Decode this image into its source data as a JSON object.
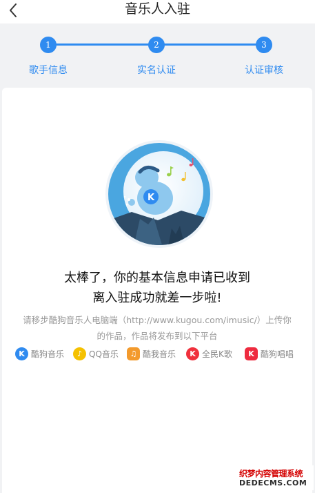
{
  "header": {
    "title": "音乐人入驻",
    "back_icon": "chevron-left-icon"
  },
  "steps": [
    {
      "number": "1",
      "label": "歌手信息"
    },
    {
      "number": "2",
      "label": "实名认证"
    },
    {
      "number": "3",
      "label": "认证审核"
    }
  ],
  "result": {
    "headline_line1": "太棒了，你的基本信息申请已收到",
    "headline_line2": "离入驻成功就差一步啦!",
    "desc_line1": "请移步酷狗音乐人电脑端（http://www.kugou.com/imusic/）上传你",
    "desc_line2": "的作品，作品将发布到以下平台"
  },
  "platforms": [
    {
      "label": "酷狗音乐",
      "icon": "kugou-icon",
      "color": "#2f8bf0",
      "glyph": "K"
    },
    {
      "label": "QQ音乐",
      "icon": "qqmusic-icon",
      "color": "#f5c100",
      "glyph": "♪"
    },
    {
      "label": "酷我音乐",
      "icon": "kuwo-icon",
      "color": "#f39a2c",
      "glyph": "♫"
    },
    {
      "label": "全民K歌",
      "icon": "quanmin-k-icon",
      "color": "#f0303c",
      "glyph": "K"
    },
    {
      "label": "酷狗唱唱",
      "icon": "kugou-changchang-icon",
      "color": "#ee2b3f",
      "glyph": "K"
    }
  ],
  "watermark": {
    "line1": "织梦内容管理系统",
    "line2": "DEDECMS.COM"
  },
  "colors": {
    "accent": "#2f8bf0",
    "background": "#f1f2f4",
    "card": "#ffffff"
  }
}
